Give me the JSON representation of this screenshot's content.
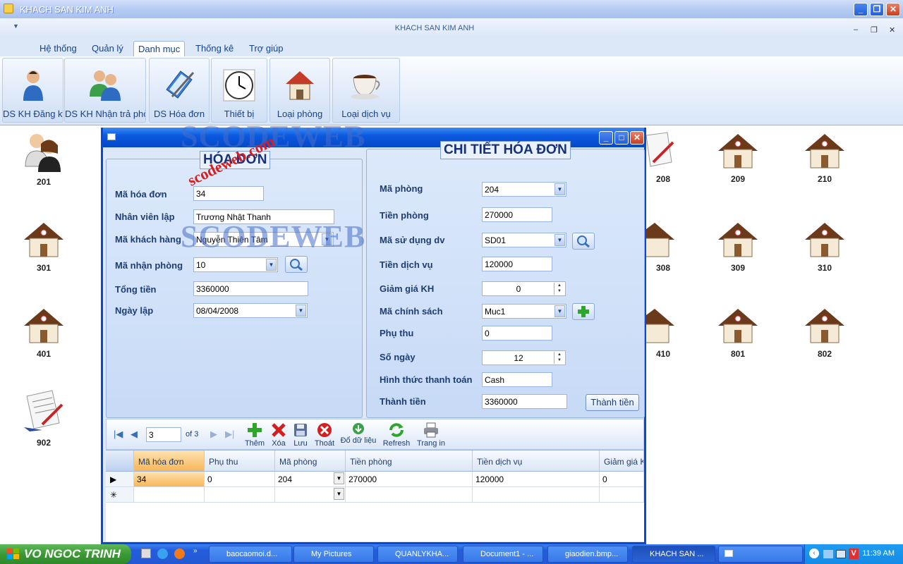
{
  "app": {
    "title": "KHACH SAN KIM ANH",
    "mdi_title": "KHACH SAN KIM ANH"
  },
  "menu": [
    "Hệ thống",
    "Quản lý",
    "Danh mục",
    "Thống kê",
    "Trợ giúp"
  ],
  "menu_active_index": 2,
  "ribbon": [
    {
      "label": "DS KH Đăng ký",
      "icon": "person-icon"
    },
    {
      "label": "DS KH Nhận trả phòng",
      "icon": "people-icon"
    },
    {
      "label": "DS Hóa đơn",
      "icon": "book-pen-icon"
    },
    {
      "label": "Thiết bị",
      "icon": "clock-icon"
    },
    {
      "label": "Loại phòng",
      "icon": "house-icon"
    },
    {
      "label": "Loại dịch vụ",
      "icon": "coffee-cup-icon"
    }
  ],
  "rooms": [
    "201",
    "209",
    "210",
    "301",
    "308",
    "309",
    "310",
    "401",
    "410",
    "801",
    "802",
    "902",
    "208"
  ],
  "hoadon": {
    "title": "HÓA ĐƠN",
    "fields": [
      {
        "label": "Mã hóa đơn",
        "value": "34"
      },
      {
        "label": "Nhân viên lập",
        "value": "Trương Nhật Thanh"
      },
      {
        "label": "Mã khách hàng",
        "value": "Nguyễn Thiên Tâm"
      },
      {
        "label": "Mã nhận phòng",
        "value": "10"
      },
      {
        "label": "Tổng tiền",
        "value": "3360000"
      },
      {
        "label": "Ngày lập",
        "value": "08/04/2008"
      }
    ]
  },
  "chitiet": {
    "title": "CHI TIẾT HÓA ĐƠN",
    "fields": [
      {
        "label": "Mã phòng",
        "value": "204"
      },
      {
        "label": "Tiền phòng",
        "value": "270000"
      },
      {
        "label": "Mã sử dụng dv",
        "value": "SD01"
      },
      {
        "label": "Tiền dịch vụ",
        "value": "120000"
      },
      {
        "label": "Giảm giá KH",
        "value": "0"
      },
      {
        "label": "Mã chính sách",
        "value": "Muc1"
      },
      {
        "label": "Phụ thu",
        "value": "0"
      },
      {
        "label": "Số ngày",
        "value": "12"
      },
      {
        "label": "Hình thức thanh toán",
        "value": "Cash"
      },
      {
        "label": "Thành tiền",
        "value": "3360000"
      }
    ],
    "calc_button": "Thành tiền"
  },
  "navigator": {
    "position": "3",
    "of": "of 3",
    "buttons": [
      "Thêm",
      "Xóa",
      "Lưu",
      "Thoát",
      "Đổ dữ liệu",
      "Refresh",
      "Trang in"
    ]
  },
  "grid": {
    "columns": [
      "Mã hóa đơn",
      "Phụ thu",
      "Mã phòng",
      "Tiền phòng",
      "Tiền dịch vụ",
      "Giảm giá KH"
    ],
    "rows": [
      [
        "34",
        "0",
        "204",
        "270000",
        "120000",
        "0"
      ]
    ]
  },
  "watermark": {
    "brand": "SCODEWEB",
    "url": "scodeweb.com"
  },
  "taskbar": {
    "start_label": "VO NGOC TRINH",
    "tasks": [
      "baocaomoi.d...",
      "My Pictures",
      "QUANLYKHA...",
      "Document1 - ...",
      "giaodien.bmp...",
      "KHACH SAN ..."
    ],
    "clock": "11:39 AM"
  },
  "colors": {
    "accent": "#0a49d6",
    "panel": "#dce8f8",
    "title_text": "#16307a",
    "taskbar": "#245ddb",
    "start": "#3a9a33"
  }
}
